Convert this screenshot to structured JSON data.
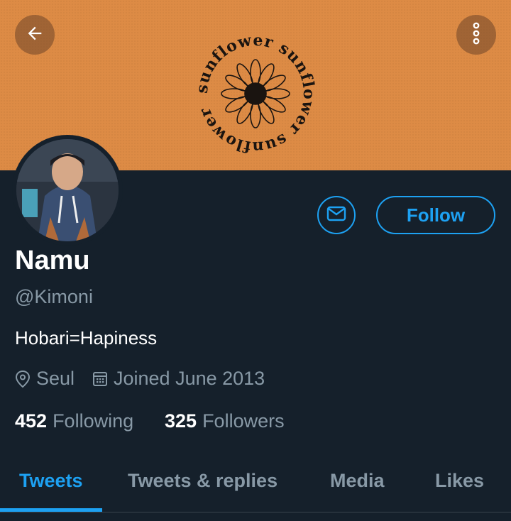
{
  "colors": {
    "accent": "#1da1f2",
    "background": "#15202b",
    "banner": "#dd8b45"
  },
  "banner": {
    "logo_text": "sunflower sunflower sunflower"
  },
  "header": {
    "back_icon": "arrow-left-icon",
    "more_icon": "more-vertical-icon"
  },
  "profile": {
    "name": "Namu",
    "handle": "@Kimoni",
    "bio": "Hobari=Hapiness",
    "location": "Seul",
    "joined": "Joined June 2013",
    "following_count": "452",
    "following_label": "Following",
    "followers_count": "325",
    "followers_label": "Followers"
  },
  "actions": {
    "follow_label": "Follow",
    "message_icon": "mail-icon"
  },
  "tabs": [
    {
      "label": "Tweets",
      "active": true
    },
    {
      "label": "Tweets & replies",
      "active": false
    },
    {
      "label": "Media",
      "active": false
    },
    {
      "label": "Likes",
      "active": false
    }
  ]
}
